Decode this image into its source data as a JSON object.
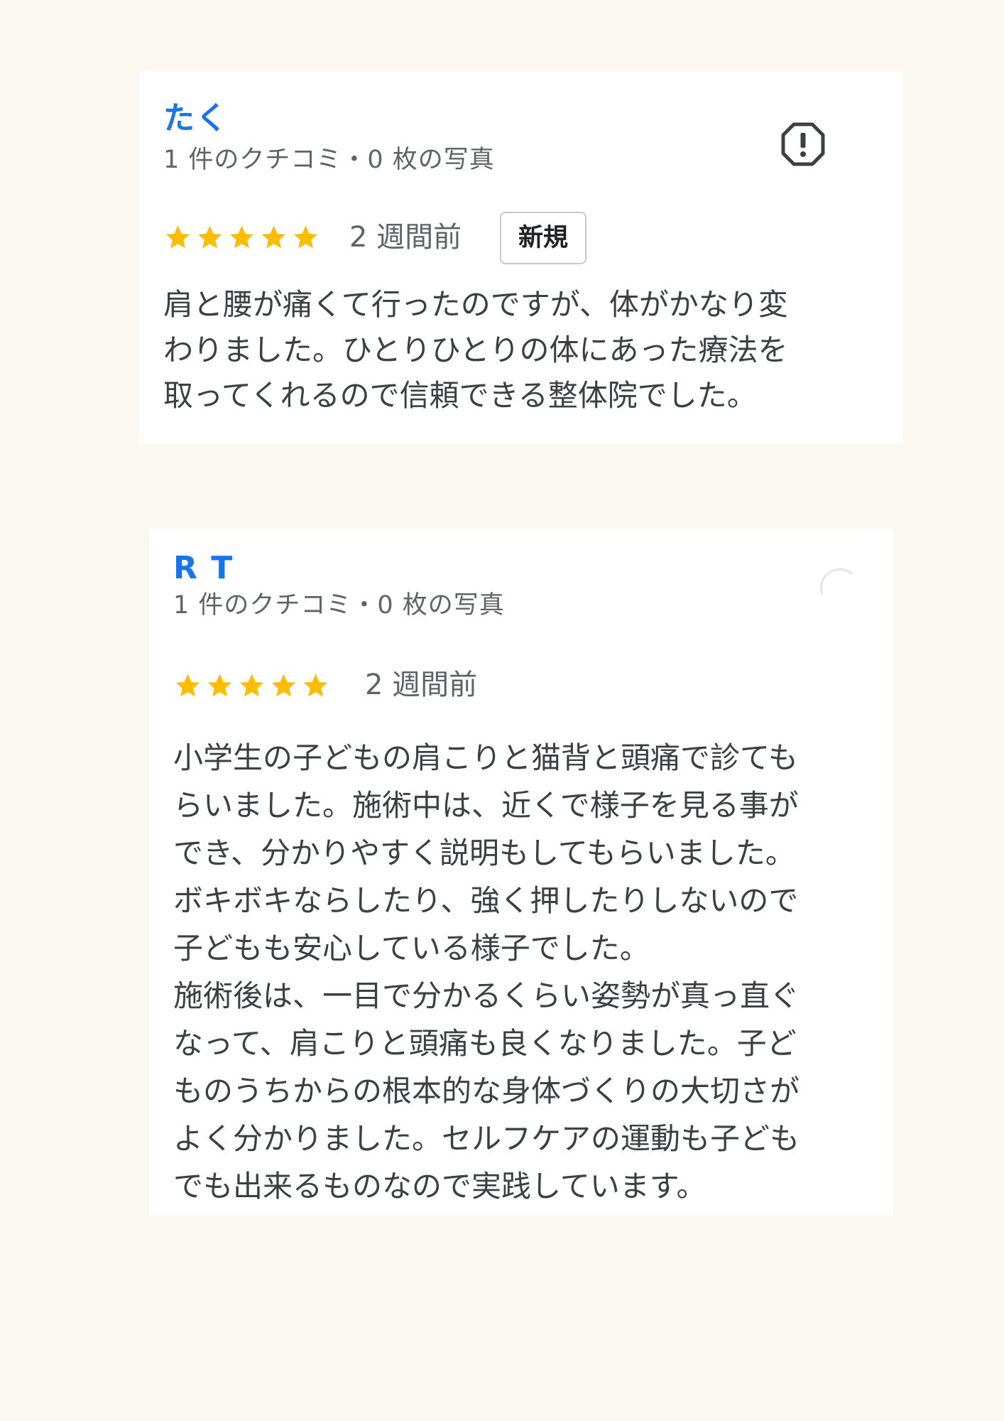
{
  "reviews": [
    {
      "name": "たく",
      "meta": "1 件のクチコミ・0 枚の写真",
      "rating": 5,
      "date": "2 週間前",
      "badge": "新規",
      "text_lines": [
        "肩と腰が痛くて行ったのですが、体がかなり変",
        "わりました。ひとりひとりの体にあった療法を",
        "取ってくれるので信頼できる整体院でした。"
      ],
      "icon": "report-flag-icon"
    },
    {
      "name": "R T",
      "meta": "1 件のクチコミ・0 枚の写真",
      "rating": 5,
      "date": "2 週間前",
      "text_lines": [
        "小学生の子どもの肩こりと猫背と頭痛で診ても",
        "らいました。施術中は、近くで様子を見る事が",
        "でき、分かりやすく説明もしてもらいました。",
        "ボキボキならしたり、強く押したりしないので",
        "子どもも安心している様子でした。",
        "施術後は、一目で分かるくらい姿勢が真っ直ぐ",
        "なって、肩こりと頭痛も良くなりました。子ど",
        "ものうちからの根本的な身体づくりの大切さが",
        "よく分かりました。セルフケアの運動も子ども",
        "でも出来るものなので実践しています。"
      ]
    }
  ],
  "colors": {
    "page_background": "#fbf8f1",
    "card_background": "#ffffff",
    "reviewer_name": "#1a73e8",
    "star": "#fbbc04",
    "secondary_text": "#5f6368",
    "body_text": "#3c4043"
  }
}
